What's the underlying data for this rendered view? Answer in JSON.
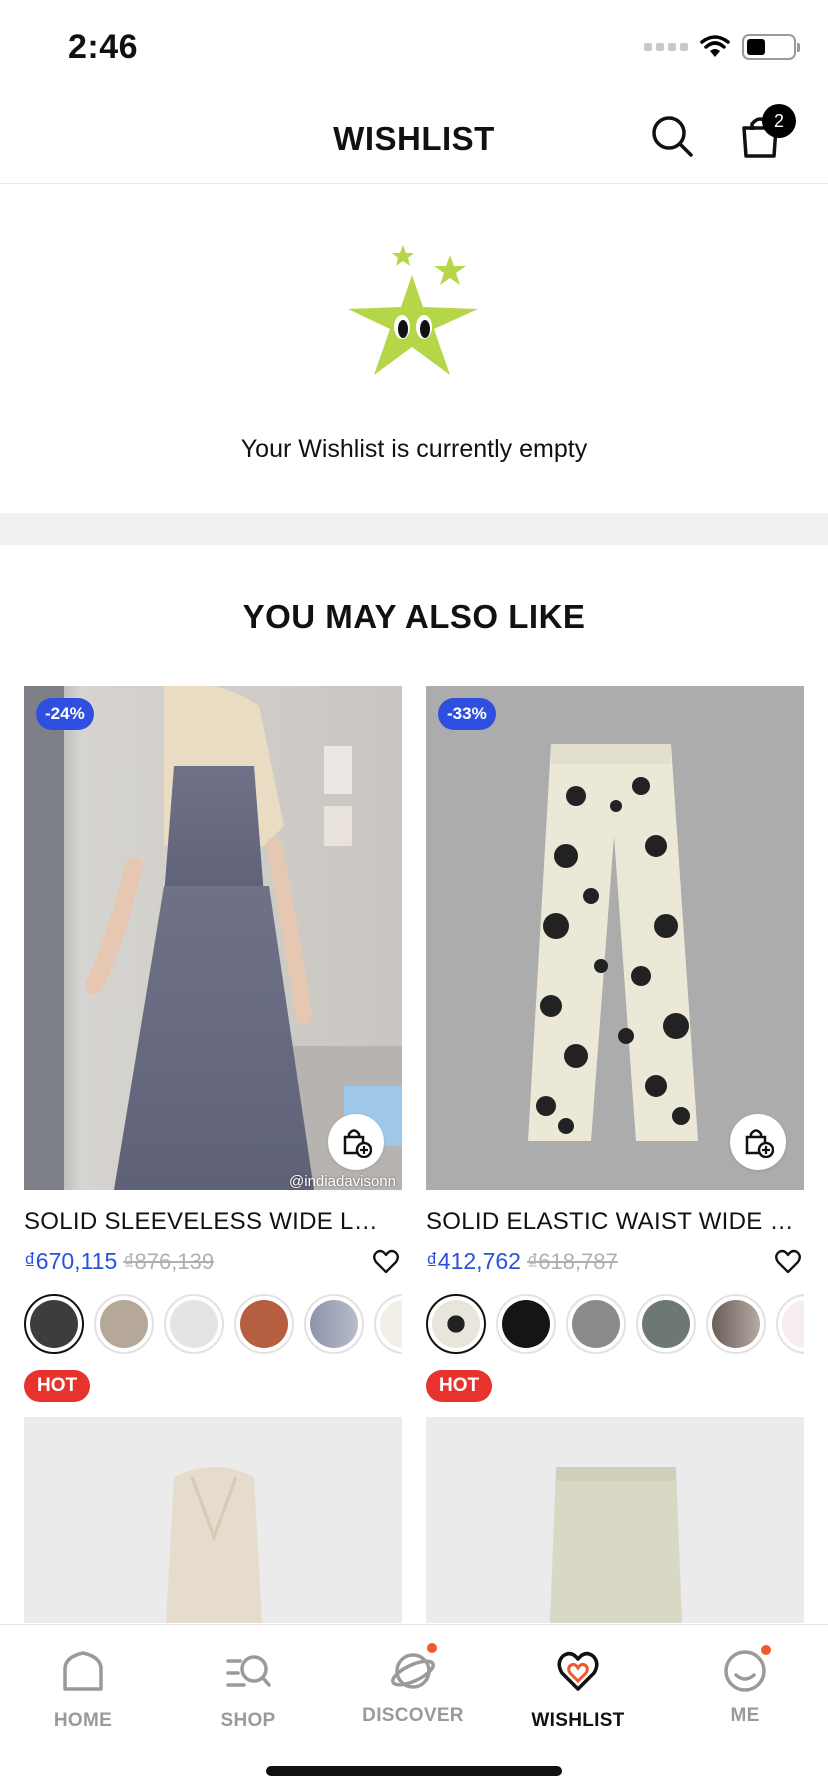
{
  "status_bar": {
    "time": "2:46"
  },
  "header": {
    "title": "WISHLIST",
    "cart_count": "2"
  },
  "empty_state": {
    "message": "Your Wishlist is currently empty"
  },
  "recommendations": {
    "title": "YOU MAY ALSO LIKE",
    "products": [
      {
        "name": "SOLID SLEEVELESS WIDE LEG...",
        "price": "₫670,115",
        "old_price": "₫876,139",
        "discount": "-24%",
        "watermark": "@indiadavisonn",
        "tag": "HOT",
        "swatches": [
          "#3d3d3d",
          "#b5a899",
          "#e4e4e4",
          "#b65e40",
          "#8c94a8",
          "#f2efe8"
        ]
      },
      {
        "name": "SOLID ELASTIC WAIST WIDE L...",
        "price": "₫412,762",
        "old_price": "₫618,787",
        "discount": "-33%",
        "tag": "HOT",
        "swatches": [
          "#e8e6dc",
          "#151515",
          "#8a8a8a",
          "#6e7873",
          "#857670",
          "#f6eeee"
        ]
      }
    ]
  },
  "tab_bar": {
    "tabs": [
      {
        "label": "HOME",
        "icon": "home-icon"
      },
      {
        "label": "SHOP",
        "icon": "shop-search-icon"
      },
      {
        "label": "DISCOVER",
        "icon": "planet-icon"
      },
      {
        "label": "WISHLIST",
        "icon": "heart-icon"
      },
      {
        "label": "ME",
        "icon": "smiley-icon"
      }
    ],
    "active": "WISHLIST"
  },
  "colors": {
    "price_blue": "#2b4ee0",
    "badge_blue": "#2f4fe0",
    "hot_red": "#e8322e",
    "star_green": "#b6d64a",
    "notification_orange": "#f05a2a"
  }
}
